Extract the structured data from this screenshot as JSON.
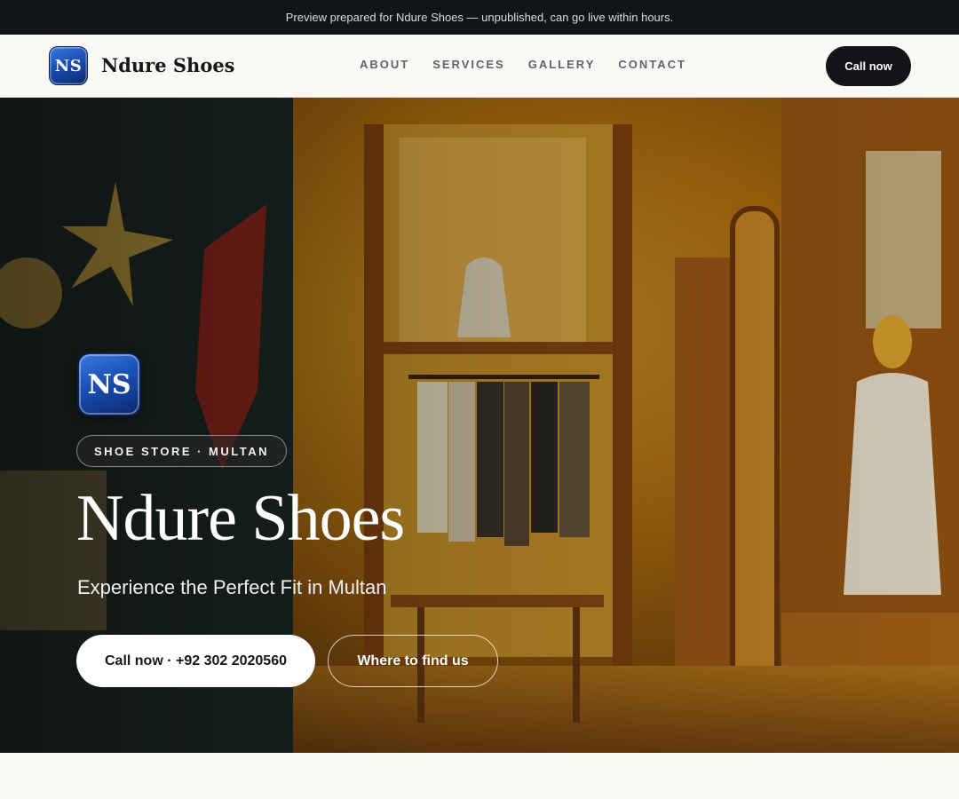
{
  "announcement": "Preview prepared for Ndure Shoes — unpublished, can go live within hours.",
  "brand": {
    "initials": "NS",
    "name": "Ndure Shoes"
  },
  "nav": {
    "items": [
      {
        "label": "ABOUT"
      },
      {
        "label": "SERVICES"
      },
      {
        "label": "GALLERY"
      },
      {
        "label": "CONTACT"
      }
    ],
    "cta_label": "Call now"
  },
  "hero": {
    "tag": "SHOE STORE · MULTAN",
    "title": "Ndure Shoes",
    "subtitle": "Experience the Perfect Fit in Multan",
    "primary_cta": "Call now · +92 302 2020560",
    "secondary_cta": "Where to find us"
  },
  "colors": {
    "topbar_bg": "#111418",
    "page_bg": "#faf9f6",
    "dark_button": "#121418",
    "badge_blue": "#1a4fb3",
    "store_amber": "#c98a1a"
  }
}
